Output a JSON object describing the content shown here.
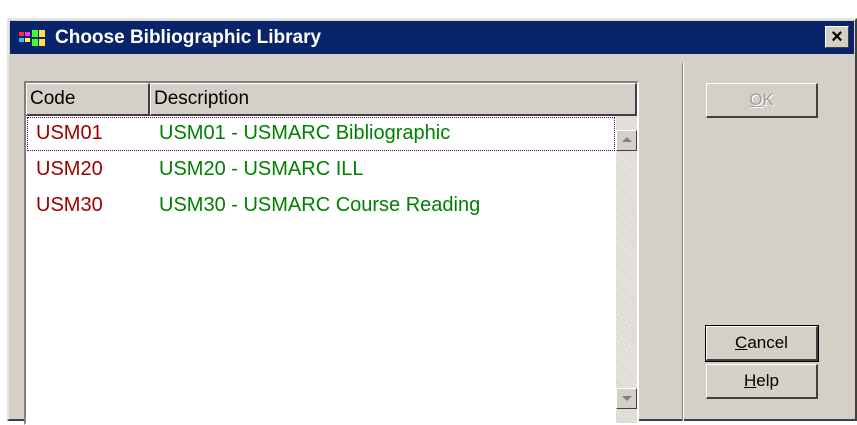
{
  "window": {
    "title": "Choose Bibliographic Library",
    "close_glyph": "×"
  },
  "list": {
    "columns": [
      "Code",
      "Description"
    ],
    "rows": [
      {
        "code": "USM01",
        "description": "USM01 - USMARC Bibliographic"
      },
      {
        "code": "USM20",
        "description": "USM20 - USMARC ILL"
      },
      {
        "code": "USM30",
        "description": "USM30 - USMARC Course Reading"
      }
    ],
    "selected_index": 0
  },
  "buttons": {
    "ok": {
      "mnemonic": "O",
      "rest": "K",
      "enabled": false
    },
    "cancel": {
      "mnemonic": "C",
      "rest": "ancel"
    },
    "help": {
      "mnemonic": "H",
      "rest": "elp"
    }
  },
  "colors": {
    "titlebar": "#0a246a",
    "code_text": "#990000",
    "description_text": "#008000"
  }
}
